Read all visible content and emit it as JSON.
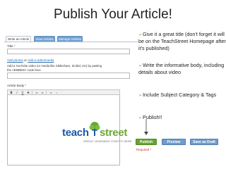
{
  "slide": {
    "title": "Publish Your Article!"
  },
  "tabs": [
    {
      "label": "Write an Article",
      "active": true
    },
    {
      "label": "View Articles",
      "active": false
    },
    {
      "label": "Manage Articles",
      "active": false
    }
  ],
  "form": {
    "title_label": "Title",
    "required_mark": "*",
    "add_photos_link": "Add photos",
    "or_text": "or",
    "add_video_link": "Add a video/media",
    "embed_help_line1": "Add a YouTube video (or media like Slideshare, Scribd, etc) by pasting",
    "embed_help_line2": "the <EMBED> code here",
    "article_body_label": "Article Body",
    "toolbar": {
      "bold": "B",
      "italic": "I",
      "underline": "U",
      "strike": "S",
      "bullets": "≡",
      "numbers": "≡",
      "link": "∞",
      "unlink": "∞"
    }
  },
  "bullets": [
    "Give it a great title (don’t forget it will be on the TeachStreet Homepage after it’s published)",
    "Write the informative body,  including details about video",
    "Include Subject Category & Tags",
    "Publish!!"
  ],
  "buttons": {
    "publish": "Publish",
    "preview": "Preview",
    "save_draft": "Save as Draft"
  },
  "required_note": "Required *",
  "logo": {
    "part1": "teach",
    "part2": "street",
    "tagline": "GREAT LEARNING STARTS HERE"
  },
  "colors": {
    "logo_teach": "#1a5aa8",
    "logo_street": "#6aa834",
    "bullet_arrow": "#8ab04c",
    "green_button": "#66a332",
    "blue_button": "#6e9ccb",
    "link": "#2a6fb3",
    "required": "#dd2233"
  },
  "icons": {
    "bullet": "arrow-bullet-icon",
    "logo_mark": "tree-logo-icon"
  }
}
